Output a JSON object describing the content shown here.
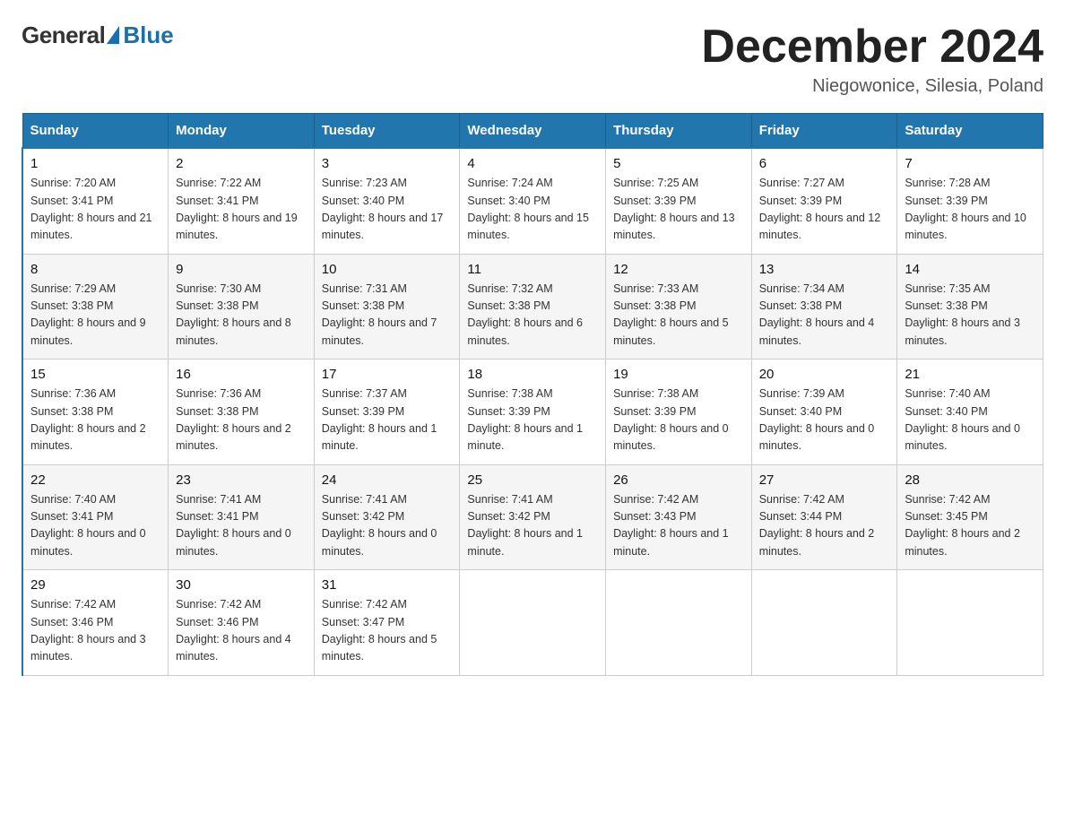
{
  "logo": {
    "general": "General",
    "blue": "Blue"
  },
  "title": {
    "month": "December 2024",
    "location": "Niegowonice, Silesia, Poland"
  },
  "headers": [
    "Sunday",
    "Monday",
    "Tuesday",
    "Wednesday",
    "Thursday",
    "Friday",
    "Saturday"
  ],
  "weeks": [
    [
      {
        "day": "1",
        "sunrise": "Sunrise: 7:20 AM",
        "sunset": "Sunset: 3:41 PM",
        "daylight": "Daylight: 8 hours and 21 minutes."
      },
      {
        "day": "2",
        "sunrise": "Sunrise: 7:22 AM",
        "sunset": "Sunset: 3:41 PM",
        "daylight": "Daylight: 8 hours and 19 minutes."
      },
      {
        "day": "3",
        "sunrise": "Sunrise: 7:23 AM",
        "sunset": "Sunset: 3:40 PM",
        "daylight": "Daylight: 8 hours and 17 minutes."
      },
      {
        "day": "4",
        "sunrise": "Sunrise: 7:24 AM",
        "sunset": "Sunset: 3:40 PM",
        "daylight": "Daylight: 8 hours and 15 minutes."
      },
      {
        "day": "5",
        "sunrise": "Sunrise: 7:25 AM",
        "sunset": "Sunset: 3:39 PM",
        "daylight": "Daylight: 8 hours and 13 minutes."
      },
      {
        "day": "6",
        "sunrise": "Sunrise: 7:27 AM",
        "sunset": "Sunset: 3:39 PM",
        "daylight": "Daylight: 8 hours and 12 minutes."
      },
      {
        "day": "7",
        "sunrise": "Sunrise: 7:28 AM",
        "sunset": "Sunset: 3:39 PM",
        "daylight": "Daylight: 8 hours and 10 minutes."
      }
    ],
    [
      {
        "day": "8",
        "sunrise": "Sunrise: 7:29 AM",
        "sunset": "Sunset: 3:38 PM",
        "daylight": "Daylight: 8 hours and 9 minutes."
      },
      {
        "day": "9",
        "sunrise": "Sunrise: 7:30 AM",
        "sunset": "Sunset: 3:38 PM",
        "daylight": "Daylight: 8 hours and 8 minutes."
      },
      {
        "day": "10",
        "sunrise": "Sunrise: 7:31 AM",
        "sunset": "Sunset: 3:38 PM",
        "daylight": "Daylight: 8 hours and 7 minutes."
      },
      {
        "day": "11",
        "sunrise": "Sunrise: 7:32 AM",
        "sunset": "Sunset: 3:38 PM",
        "daylight": "Daylight: 8 hours and 6 minutes."
      },
      {
        "day": "12",
        "sunrise": "Sunrise: 7:33 AM",
        "sunset": "Sunset: 3:38 PM",
        "daylight": "Daylight: 8 hours and 5 minutes."
      },
      {
        "day": "13",
        "sunrise": "Sunrise: 7:34 AM",
        "sunset": "Sunset: 3:38 PM",
        "daylight": "Daylight: 8 hours and 4 minutes."
      },
      {
        "day": "14",
        "sunrise": "Sunrise: 7:35 AM",
        "sunset": "Sunset: 3:38 PM",
        "daylight": "Daylight: 8 hours and 3 minutes."
      }
    ],
    [
      {
        "day": "15",
        "sunrise": "Sunrise: 7:36 AM",
        "sunset": "Sunset: 3:38 PM",
        "daylight": "Daylight: 8 hours and 2 minutes."
      },
      {
        "day": "16",
        "sunrise": "Sunrise: 7:36 AM",
        "sunset": "Sunset: 3:38 PM",
        "daylight": "Daylight: 8 hours and 2 minutes."
      },
      {
        "day": "17",
        "sunrise": "Sunrise: 7:37 AM",
        "sunset": "Sunset: 3:39 PM",
        "daylight": "Daylight: 8 hours and 1 minute."
      },
      {
        "day": "18",
        "sunrise": "Sunrise: 7:38 AM",
        "sunset": "Sunset: 3:39 PM",
        "daylight": "Daylight: 8 hours and 1 minute."
      },
      {
        "day": "19",
        "sunrise": "Sunrise: 7:38 AM",
        "sunset": "Sunset: 3:39 PM",
        "daylight": "Daylight: 8 hours and 0 minutes."
      },
      {
        "day": "20",
        "sunrise": "Sunrise: 7:39 AM",
        "sunset": "Sunset: 3:40 PM",
        "daylight": "Daylight: 8 hours and 0 minutes."
      },
      {
        "day": "21",
        "sunrise": "Sunrise: 7:40 AM",
        "sunset": "Sunset: 3:40 PM",
        "daylight": "Daylight: 8 hours and 0 minutes."
      }
    ],
    [
      {
        "day": "22",
        "sunrise": "Sunrise: 7:40 AM",
        "sunset": "Sunset: 3:41 PM",
        "daylight": "Daylight: 8 hours and 0 minutes."
      },
      {
        "day": "23",
        "sunrise": "Sunrise: 7:41 AM",
        "sunset": "Sunset: 3:41 PM",
        "daylight": "Daylight: 8 hours and 0 minutes."
      },
      {
        "day": "24",
        "sunrise": "Sunrise: 7:41 AM",
        "sunset": "Sunset: 3:42 PM",
        "daylight": "Daylight: 8 hours and 0 minutes."
      },
      {
        "day": "25",
        "sunrise": "Sunrise: 7:41 AM",
        "sunset": "Sunset: 3:42 PM",
        "daylight": "Daylight: 8 hours and 1 minute."
      },
      {
        "day": "26",
        "sunrise": "Sunrise: 7:42 AM",
        "sunset": "Sunset: 3:43 PM",
        "daylight": "Daylight: 8 hours and 1 minute."
      },
      {
        "day": "27",
        "sunrise": "Sunrise: 7:42 AM",
        "sunset": "Sunset: 3:44 PM",
        "daylight": "Daylight: 8 hours and 2 minutes."
      },
      {
        "day": "28",
        "sunrise": "Sunrise: 7:42 AM",
        "sunset": "Sunset: 3:45 PM",
        "daylight": "Daylight: 8 hours and 2 minutes."
      }
    ],
    [
      {
        "day": "29",
        "sunrise": "Sunrise: 7:42 AM",
        "sunset": "Sunset: 3:46 PM",
        "daylight": "Daylight: 8 hours and 3 minutes."
      },
      {
        "day": "30",
        "sunrise": "Sunrise: 7:42 AM",
        "sunset": "Sunset: 3:46 PM",
        "daylight": "Daylight: 8 hours and 4 minutes."
      },
      {
        "day": "31",
        "sunrise": "Sunrise: 7:42 AM",
        "sunset": "Sunset: 3:47 PM",
        "daylight": "Daylight: 8 hours and 5 minutes."
      },
      null,
      null,
      null,
      null
    ]
  ]
}
